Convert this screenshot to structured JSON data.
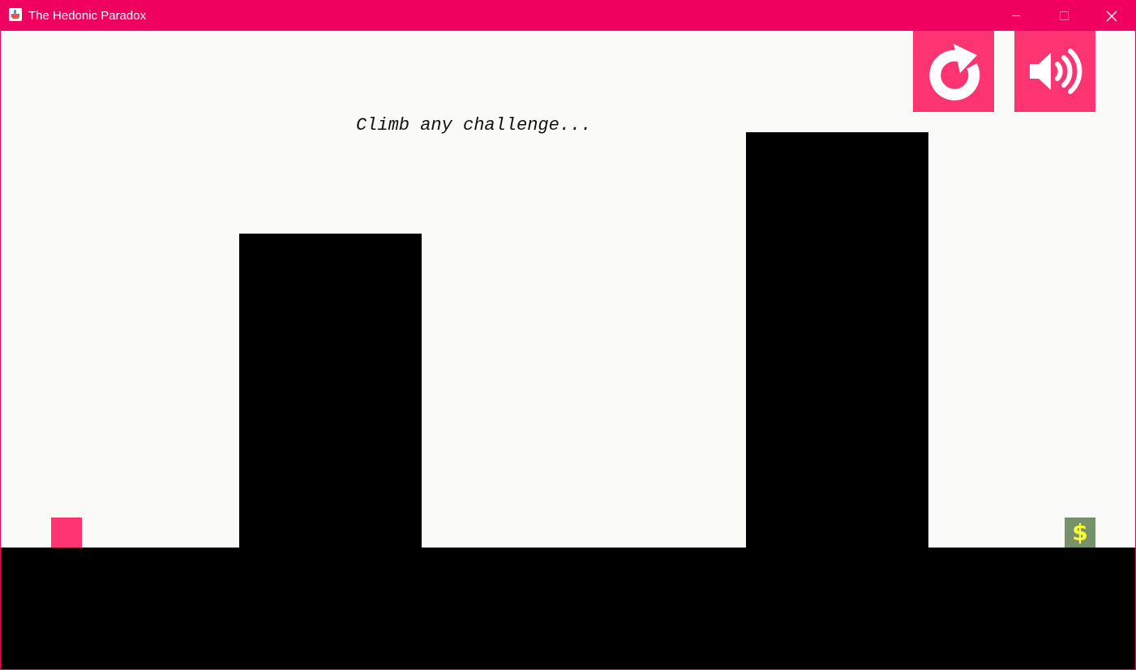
{
  "window": {
    "title": "The Hedonic Paradox"
  },
  "titlebar_icons": {
    "app": "java-coffee-cup-icon",
    "minimize": "minimize-icon",
    "maximize": "maximize-icon",
    "close": "close-icon"
  },
  "hud": {
    "restart_icon": "restart-icon",
    "sound_icon": "speaker-volume-icon"
  },
  "level": {
    "hint": "Climb any challenge...",
    "goal_symbol": "$"
  },
  "colors": {
    "titlebar": "#f0005f",
    "accent": "#ff3473",
    "background": "#fafaf8",
    "terrain": "#000000",
    "goal_bg": "#75926a",
    "goal_symbol": "#ffff33"
  }
}
